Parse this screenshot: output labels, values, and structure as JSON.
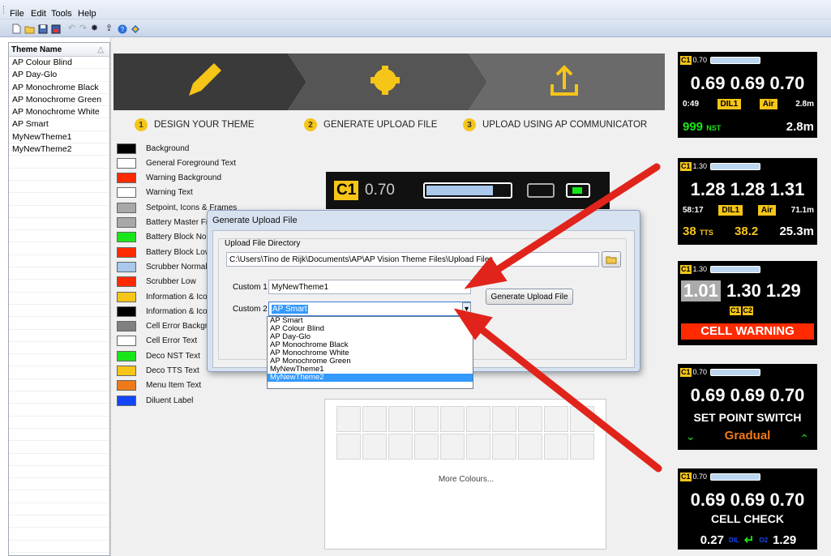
{
  "menu": {
    "items": [
      "File",
      "Edit",
      "Tools",
      "Help"
    ]
  },
  "toolbar": {
    "icons": [
      "new-icon",
      "open-icon",
      "save-icon",
      "save-as-icon",
      "undo-icon",
      "redo-icon",
      "settings-icon",
      "upload-icon",
      "help-icon",
      "info-icon"
    ]
  },
  "sidebar": {
    "header": "Theme Name",
    "items": [
      "AP Colour Blind",
      "AP Day-Glo",
      "AP Monochrome Black",
      "AP Monochrome Green",
      "AP Monochrome White",
      "AP Smart",
      "MyNewTheme1",
      "MyNewTheme2"
    ]
  },
  "steps": [
    {
      "num": "1",
      "label": "DESIGN YOUR THEME"
    },
    {
      "num": "2",
      "label": "GENERATE UPLOAD FILE"
    },
    {
      "num": "3",
      "label": "UPLOAD USING AP COMMUNICATOR"
    }
  ],
  "swatches": [
    {
      "label": "Background",
      "color": "#000000"
    },
    {
      "label": "General Foreground Text",
      "color": "#ffffff"
    },
    {
      "label": "Warning Background",
      "color": "#ff2a00"
    },
    {
      "label": "Warning Text",
      "color": "#ffffff"
    },
    {
      "label": "Setpoint, Icons & Frames",
      "color": "#a8a8a8"
    },
    {
      "label": "Battery Master Fr",
      "color": "#a8a8a8"
    },
    {
      "label": "Battery Block Norr",
      "color": "#19e619"
    },
    {
      "label": "Battery Block Low",
      "color": "#ff2a00"
    },
    {
      "label": "Scrubber Normal",
      "color": "#a9c8ec"
    },
    {
      "label": "Scrubber Low",
      "color": "#ff2a00"
    },
    {
      "label": "Information & Icor",
      "color": "#f5c518"
    },
    {
      "label": "Information & Icor",
      "color": "#000000"
    },
    {
      "label": "Cell Error Backgro",
      "color": "#808080"
    },
    {
      "label": "Cell Error Text",
      "color": "#ffffff"
    },
    {
      "label": "Deco NST Text",
      "color": "#19e619"
    },
    {
      "label": "Deco TTS Text",
      "color": "#f5c518"
    },
    {
      "label": "Menu Item Text",
      "color": "#f07a1a"
    },
    {
      "label": "Diluent Label",
      "color": "#1446ff"
    }
  ],
  "preview": {
    "cell": "C1",
    "value": "0.70"
  },
  "dialog": {
    "title": "Generate Upload File",
    "dir_label": "Upload File Directory",
    "dir_value": "C:\\Users\\Tino de Rijk\\Documents\\AP\\AP Vision Theme Files\\Upload Files",
    "custom1_label": "Custom 1",
    "custom1_value": "MyNewTheme1",
    "custom2_label": "Custom 2",
    "custom2_value": "AP Smart",
    "generate_button": "Generate Upload File",
    "options": [
      "AP Smart",
      "AP Colour Blind",
      "AP Day-Glo",
      "AP Monochrome Black",
      "AP Monochrome White",
      "AP Monochrome Green",
      "MyNewTheme1",
      "MyNewTheme2"
    ],
    "selected_option": "MyNewTheme2"
  },
  "color_picker": {
    "more": "More Colours..."
  },
  "panels": [
    {
      "cell": "C1",
      "val": "0.70",
      "big": "0.69 0.69 0.70",
      "time": "0:49",
      "dil": "DIL1",
      "gas": "Air",
      "depth": "2.8m",
      "nst": "999",
      "nst_label": "NST",
      "bottom": "2.8m"
    },
    {
      "cell": "C1",
      "val": "1.30",
      "big": "1.28 1.28 1.31",
      "time": "58:17",
      "dil": "DIL1",
      "gas": "Air",
      "depth": "71.1m",
      "tts": "38",
      "tts_label": "TTS",
      "v2": "38.2",
      "v3": "25.3m"
    },
    {
      "cell": "C1",
      "val": "1.30",
      "b1": "1.01",
      "b2": "1.30 1.29",
      "tagA": "C1",
      "tagB": "C2",
      "warning": "CELL WARNING"
    },
    {
      "cell": "C1",
      "val": "0.70",
      "big": "0.69 0.69 0.70",
      "line2": "SET POINT SWITCH",
      "line3": "Gradual"
    },
    {
      "cell": "C1",
      "val": "0.70",
      "big": "0.69 0.69 0.70",
      "line2": "CELL CHECK",
      "a": "0.27",
      "dil": "DIL",
      "o2": "O2",
      "b": "1.29"
    }
  ],
  "colors": {
    "accent": "#f5c518",
    "arrow": "#e0241b",
    "selection": "#3399ff"
  }
}
